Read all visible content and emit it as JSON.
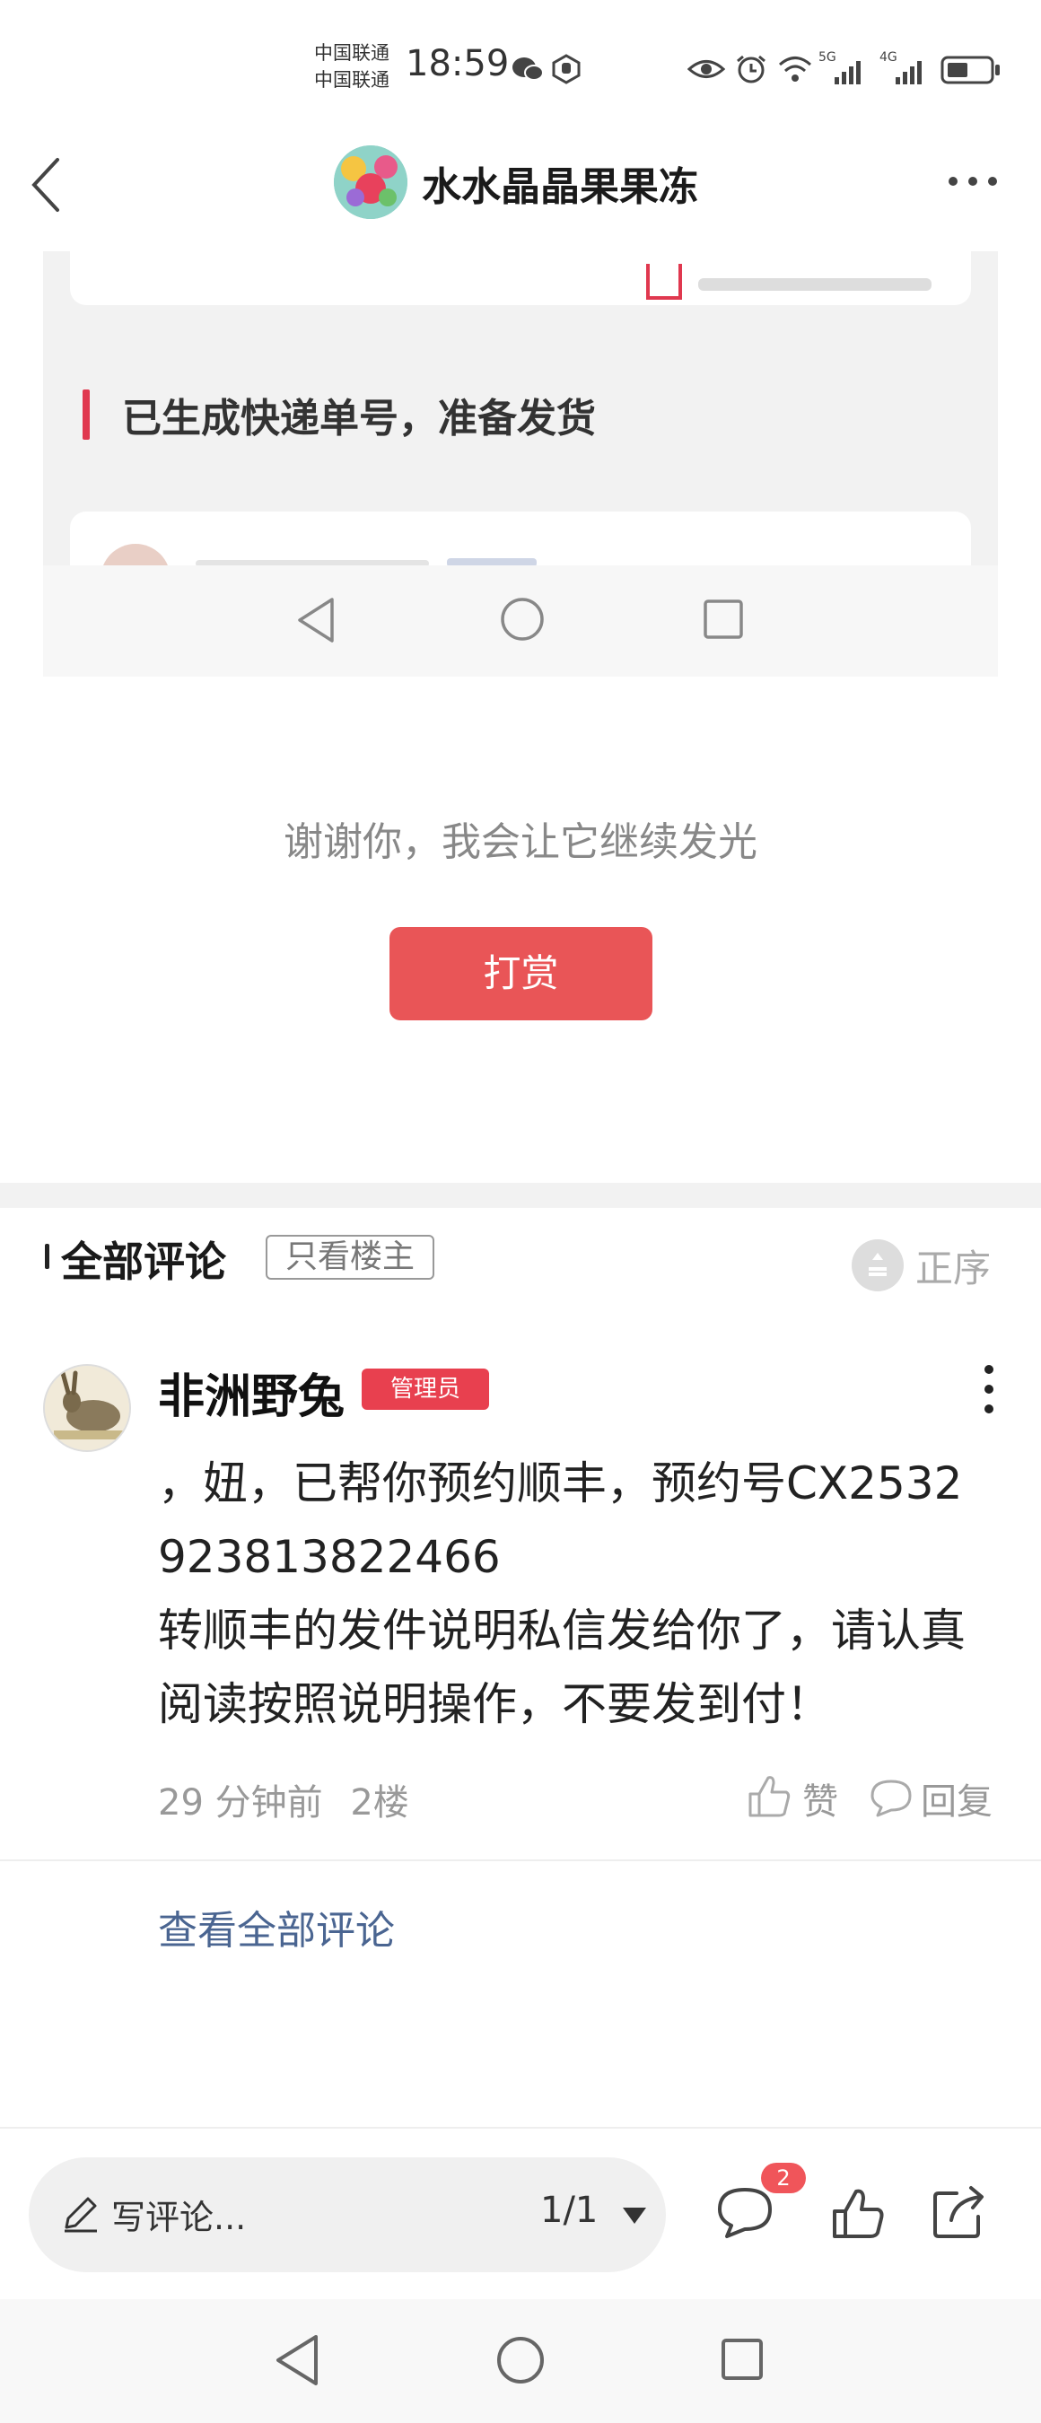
{
  "status_bar": {
    "carrier_1": "中国联通",
    "carrier_2": "中国联通",
    "time": "18:59",
    "net_5g": "5G",
    "net_4g": "4G"
  },
  "header": {
    "title": "水水晶晶果果冻"
  },
  "embedded_screenshot": {
    "heading": "已生成快递单号，准备发货"
  },
  "reward": {
    "message": "谢谢你，我会让它继续发光",
    "button_label": "打赏"
  },
  "comments": {
    "section_title": "全部评论",
    "only_op_label": "只看楼主",
    "sort_label": "正序",
    "items": [
      {
        "author": "非洲野兔",
        "badge": "管理员",
        "text_lines": [
          "，妞，已帮你预约顺丰，预约号CX2532",
          "923813822466",
          "转顺丰的发件说明私信发给你了，请认真",
          "阅读按照说明操作，不要发到付！"
        ],
        "time": "29 分钟前",
        "floor": "2楼",
        "like_label": "赞",
        "reply_label": "回复"
      }
    ],
    "view_all_label": "查看全部评论"
  },
  "bottom_bar": {
    "comment_placeholder": "写评论...",
    "pager": "1/1",
    "comment_count": "2"
  },
  "colors": {
    "accent_red": "#e95557",
    "badge_red": "#e8404f",
    "link_blue": "#4a6591"
  },
  "icons": [
    "back-arrow-icon",
    "more-horizontal-icon",
    "wechat-icon",
    "eye-icon",
    "alarm-icon",
    "wifi-icon",
    "signal-icon",
    "battery-icon",
    "sort-icon",
    "thumb-up-icon",
    "comment-bubble-icon",
    "share-icon",
    "pencil-icon",
    "triangle-down-icon",
    "nav-back-icon",
    "nav-home-icon",
    "nav-recent-icon"
  ]
}
